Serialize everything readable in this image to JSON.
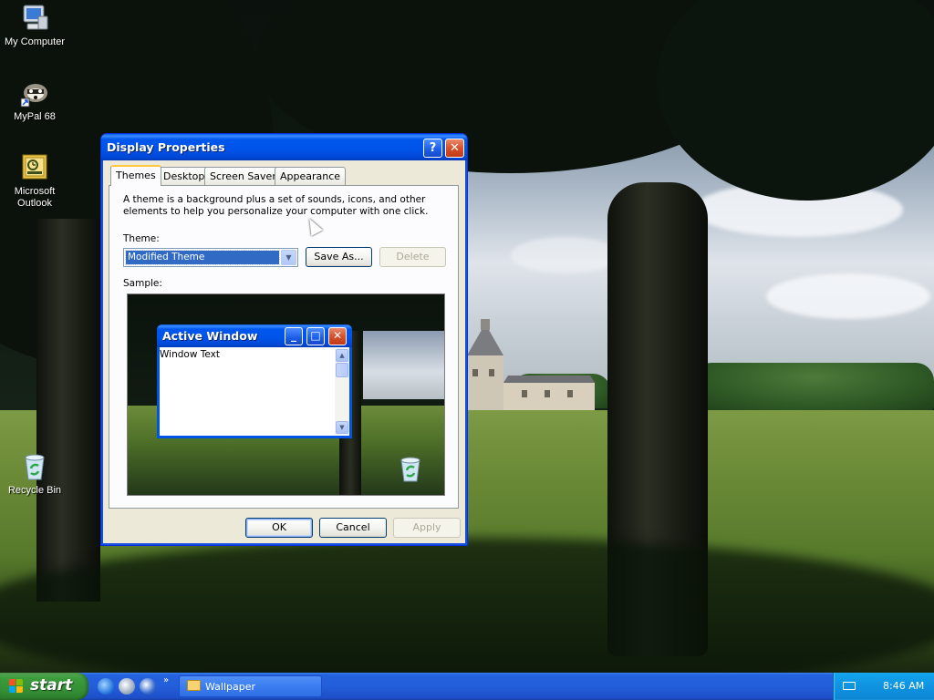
{
  "desktop": {
    "icons": [
      {
        "label": "My Computer",
        "icon": "my-computer-icon"
      },
      {
        "label": "MyPal 68",
        "icon": "mypal-browser-icon"
      },
      {
        "label": "Microsoft Outlook",
        "icon": "outlook-icon"
      },
      {
        "label": "Recycle Bin",
        "icon": "recycle-bin-icon"
      }
    ]
  },
  "dialog": {
    "title": "Display Properties",
    "help_glyph": "?",
    "close_glyph": "✕",
    "tabs": [
      {
        "label": "Themes",
        "active": true
      },
      {
        "label": "Desktop",
        "active": false
      },
      {
        "label": "Screen Saver",
        "active": false
      },
      {
        "label": "Appearance",
        "active": false
      }
    ],
    "description": "A theme is a background plus a set of sounds, icons, and other elements to help you personalize your computer with one click.",
    "theme_label": "Theme:",
    "theme_value": "Modified Theme",
    "save_as_label": "Save As...",
    "delete_label": "Delete",
    "sample_label": "Sample:",
    "sample": {
      "window_title": "Active Window",
      "window_text": "Window Text",
      "minimize_glyph": "_",
      "maximize_glyph": "□",
      "close_glyph": "✕"
    },
    "ok_label": "OK",
    "cancel_label": "Cancel",
    "apply_label": "Apply"
  },
  "taskbar": {
    "start_label": "start",
    "quick_launch": [
      "internet-explorer-icon",
      "mypal-icon",
      "media-player-icon"
    ],
    "task_button_label": "Wallpaper",
    "clock": "8:46 AM"
  },
  "colors": {
    "title_blue": "#0054e3",
    "start_green": "#3c9c3c",
    "tray_blue": "#0f93e0",
    "selection_blue": "#316ac5"
  }
}
